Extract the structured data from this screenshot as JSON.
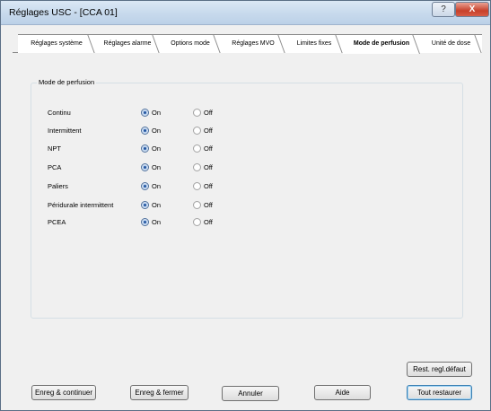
{
  "window": {
    "title": "Réglages USC - [CCA 01]",
    "help_label": "?",
    "close_label": "X"
  },
  "tabs": [
    {
      "label": "Réglages système",
      "active": false
    },
    {
      "label": "Réglages alarme",
      "active": false
    },
    {
      "label": "Options mode",
      "active": false
    },
    {
      "label": "Réglages MVO",
      "active": false
    },
    {
      "label": "Limites fixes",
      "active": false
    },
    {
      "label": "Mode de perfusion",
      "active": true
    },
    {
      "label": "Unité de dose",
      "active": false
    }
  ],
  "group": {
    "title": "Mode de perfusion",
    "on_label": "On",
    "off_label": "Off",
    "rows": [
      {
        "label": "Continu",
        "value": "On"
      },
      {
        "label": "Intermittent",
        "value": "On"
      },
      {
        "label": "NPT",
        "value": "On"
      },
      {
        "label": "PCA",
        "value": "On"
      },
      {
        "label": "Paliers",
        "value": "On"
      },
      {
        "label": "Péridurale intermittent",
        "value": "On"
      },
      {
        "label": "PCEA",
        "value": "On"
      }
    ]
  },
  "buttons": {
    "restore_default": "Rest. regl.défaut",
    "save_continue": "Enreg & continuer",
    "save_close": "Enreg & fermer",
    "cancel": "Annuler",
    "help": "Aide",
    "restore_all": "Tout restaurer"
  }
}
